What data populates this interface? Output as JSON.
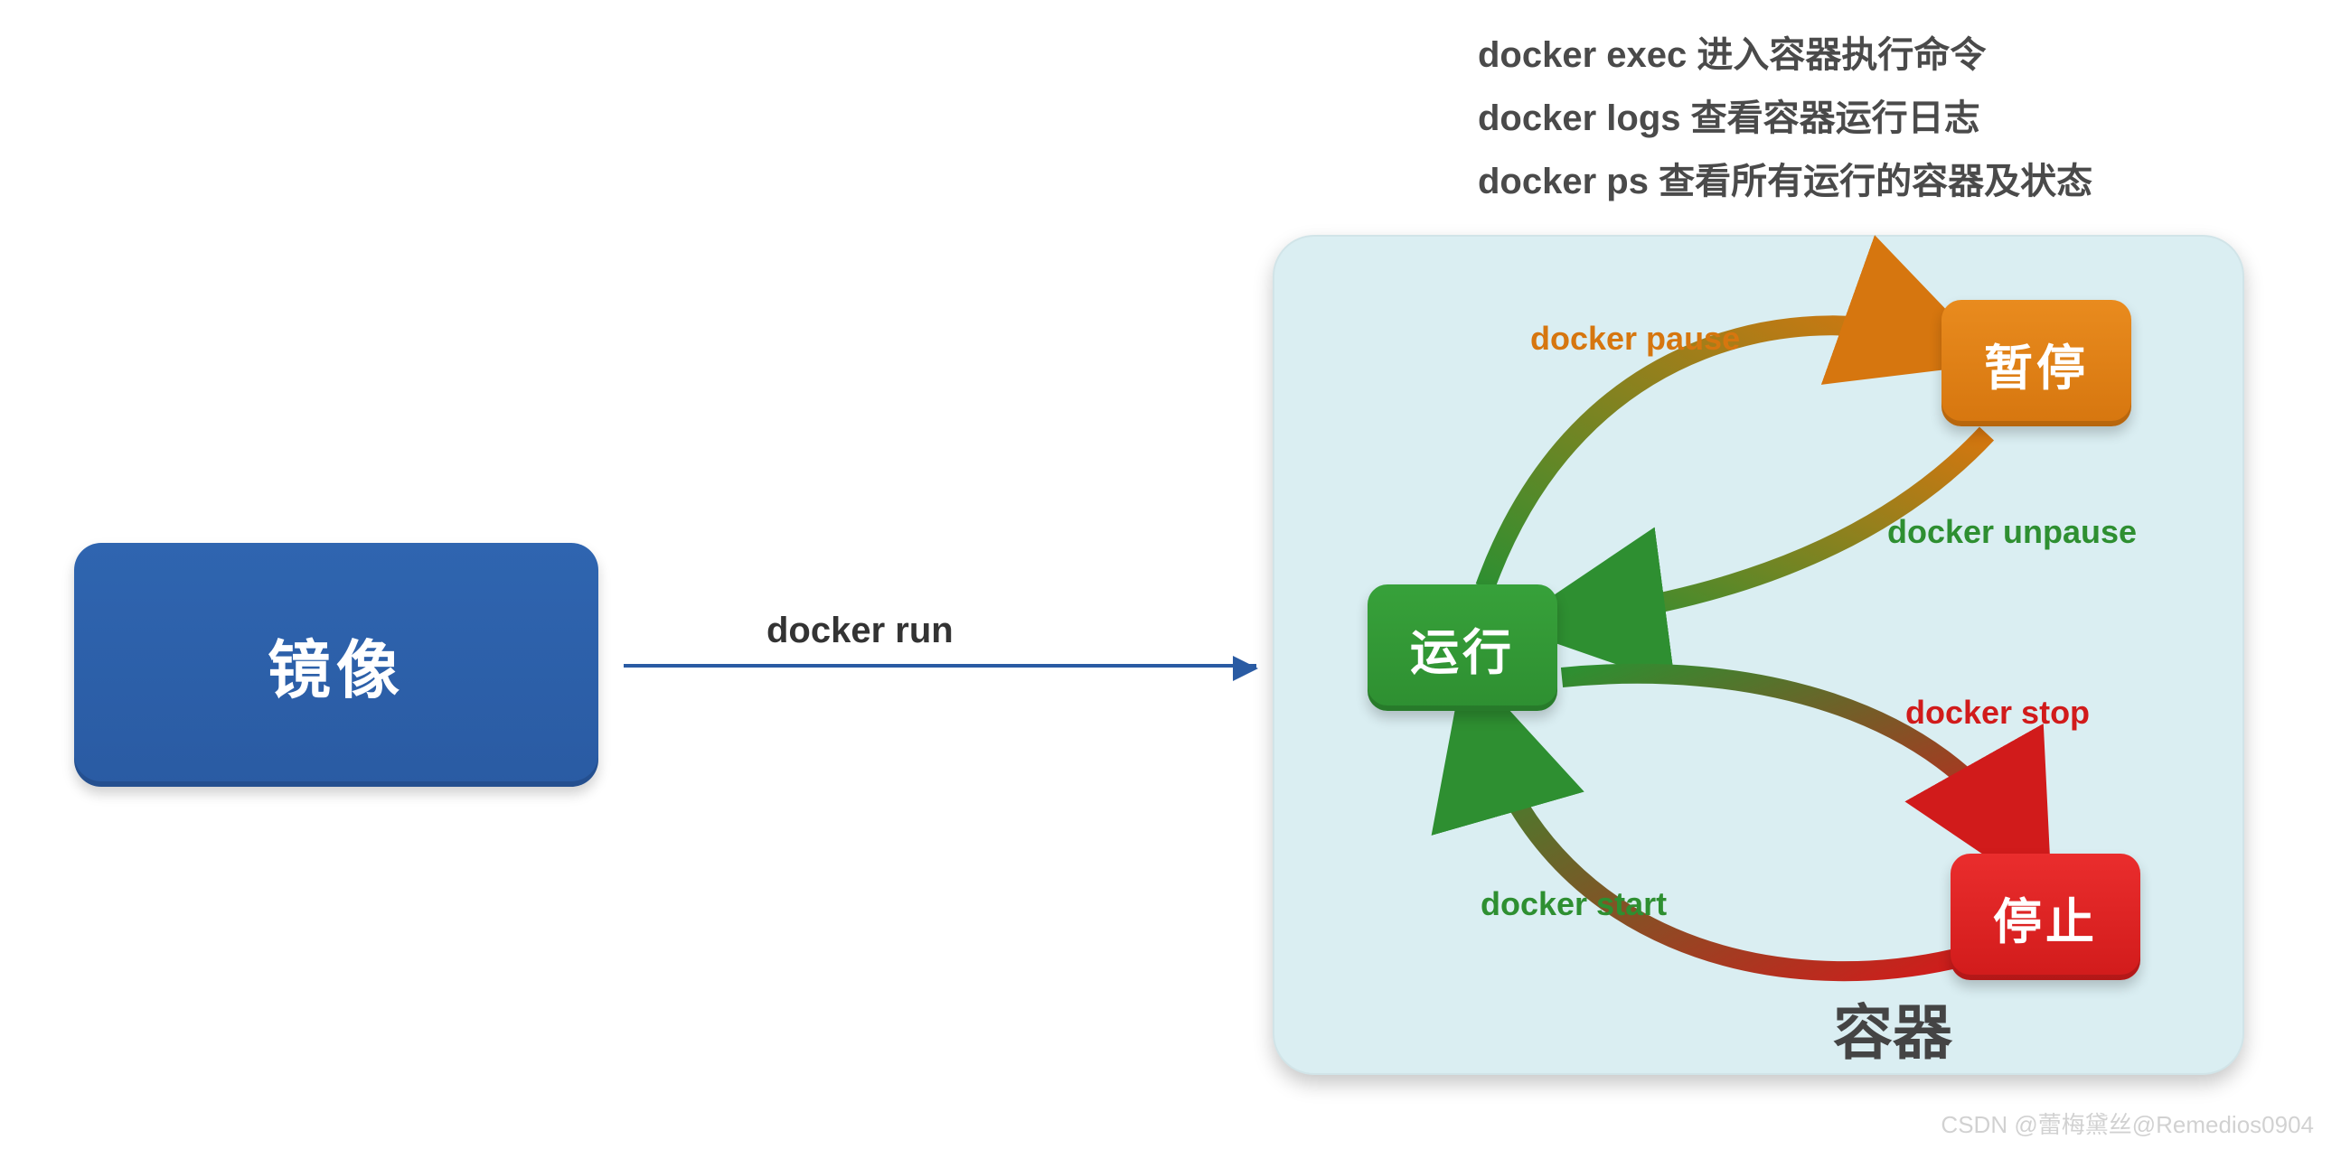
{
  "diagram": {
    "image_box": "镜像",
    "run_arrow_label": "docker run",
    "container": {
      "label": "容器",
      "states": {
        "running": "运行",
        "paused": "暂停",
        "stopped": "停止"
      },
      "transitions": {
        "pause": {
          "label": "docker pause",
          "from": "running",
          "to": "paused"
        },
        "unpause": {
          "label": "docker unpause",
          "from": "paused",
          "to": "running"
        },
        "stop": {
          "label": "docker stop",
          "from": "running",
          "to": "stopped"
        },
        "start": {
          "label": "docker start",
          "from": "stopped",
          "to": "running"
        }
      }
    },
    "commands_list": [
      "docker exec 进入容器执行命令",
      "docker logs 查看容器运行日志",
      "docker ps 查看所有运行的容器及状态"
    ],
    "colors": {
      "image_box": "#2a5ba3",
      "running": "#2e8f31",
      "paused": "#d6760f",
      "stopped": "#d11b1b",
      "panel_bg": "#daeef2"
    }
  },
  "watermark": "CSDN @蕾梅黛丝@Remedios0904"
}
